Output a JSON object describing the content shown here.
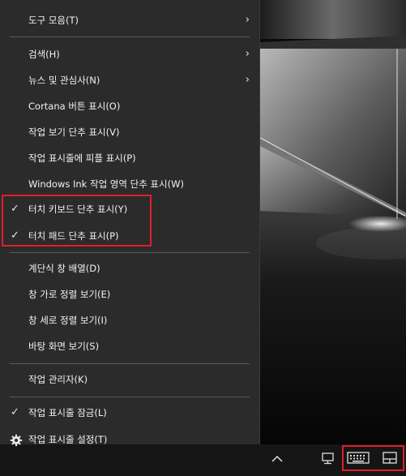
{
  "menu": {
    "items": [
      {
        "label": "도구 모음(T)",
        "submenu": true
      },
      {
        "label": "검색(H)",
        "submenu": true
      },
      {
        "label": "뉴스 및 관심사(N)",
        "submenu": true
      },
      {
        "label": "Cortana 버튼 표시(O)"
      },
      {
        "label": "작업 보기 단추 표시(V)"
      },
      {
        "label": "작업 표시줄에 피플 표시(P)"
      },
      {
        "label": "Windows Ink 작업 영역 단추 표시(W)"
      },
      {
        "label": "터치 키보드 단추 표시(Y)",
        "checked": true
      },
      {
        "label": "터치 패드 단추 표시(P)",
        "checked": true
      },
      {
        "label": "계단식 창 배열(D)"
      },
      {
        "label": "창 가로 정렬 보기(E)"
      },
      {
        "label": "창 세로 정렬 보기(I)"
      },
      {
        "label": "바탕 화면 보기(S)"
      },
      {
        "label": "작업 관리자(K)"
      },
      {
        "label": "작업 표시줄 잠금(L)",
        "checked": true
      },
      {
        "label": "작업 표시줄 설정(T)",
        "icon": "gear-icon"
      }
    ],
    "submenu_glyph": "›",
    "check_glyph": "✓"
  },
  "taskbar": {
    "icons": [
      "chevron-up-icon",
      "network-icon",
      "touch-keyboard-icon",
      "touchpad-icon"
    ]
  },
  "colors": {
    "menu_bg": "#2b2b2b",
    "menu_text": "#f2f2f2",
    "separator": "#5a5a5a",
    "highlight": "#e21d2b",
    "taskbar_bg": "#151515"
  }
}
